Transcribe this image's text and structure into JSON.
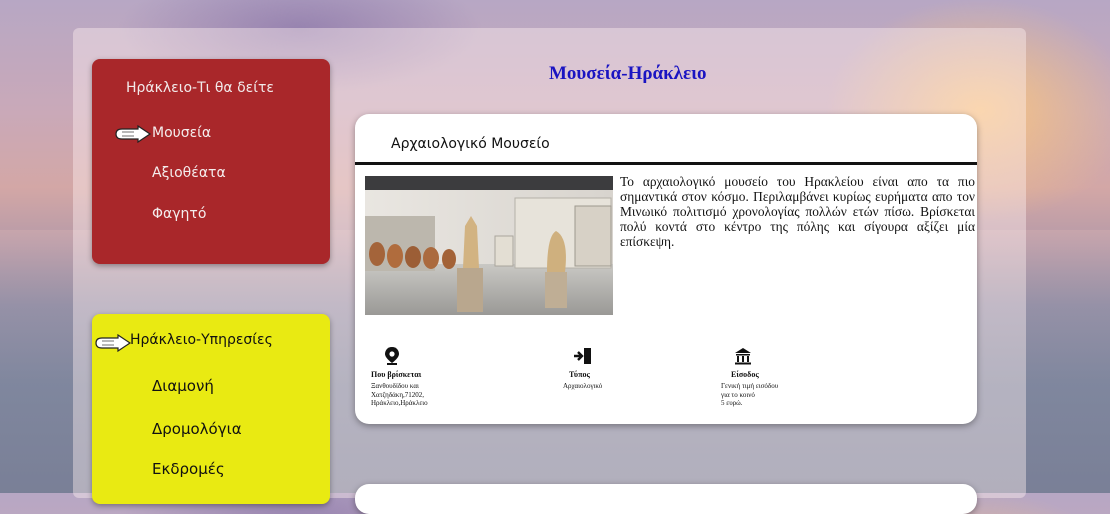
{
  "page_title": "Μουσεία-Ηράκλειο",
  "sidebar_sights": {
    "title": "Ηράκλειο-Τι θα δείτε",
    "items": [
      {
        "label": "Μουσεία",
        "active": true
      },
      {
        "label": "Αξιοθέατα",
        "active": false
      },
      {
        "label": "Φαγητό",
        "active": false
      }
    ]
  },
  "sidebar_services": {
    "title": "Ηράκλειο-Υπηρεσίες",
    "items": [
      {
        "label": "Διαμονή"
      },
      {
        "label": "Δρομολόγια"
      },
      {
        "label": "Εκδρομές"
      }
    ]
  },
  "museum_card": {
    "title": "Αρχαιολογικό Μουσείο",
    "description": "Το αρχαιολογικό μουσείο του Ηρακλείου είναι απο τα πιο σημαντικά στον κόσμο. Περιλαμβάνει κυρίως ευρήματα απο τον Μινωικό πολιτισμό χρονολογίας πολλών ετών πίσω. Βρίσκεται πολύ κοντά στο κέντρο της πόλης και σίγουρα αξίζει μία επίσκεψη.",
    "info": [
      {
        "icon": "location-pin-icon",
        "label": "Που βρίσκεται",
        "value": "Ξανθουδίδου και\nΧατζηδάκη,71202,\nΗράκλειο,Ηράκλειο"
      },
      {
        "icon": "door-entry-icon",
        "label": "Τύπος",
        "value": "Αρχαιολογικό"
      },
      {
        "icon": "museum-building-icon",
        "label": "Είσοδος",
        "value": "Γενική τιμή εισόδου\nγια το κοινό\n5 ευρώ."
      }
    ]
  },
  "colors": {
    "sights_panel": "#a9272a",
    "services_panel": "#e9ea12",
    "title_blue": "#1a14c2"
  }
}
